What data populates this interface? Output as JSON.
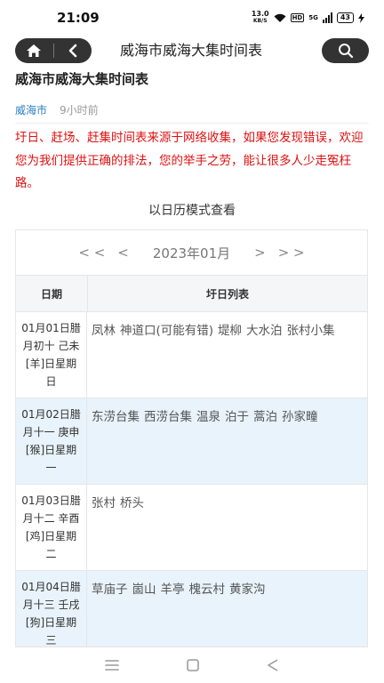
{
  "status_bar": {
    "time": "21:09",
    "net_speed": "13.0",
    "net_unit": "KB/S",
    "hd": "HD",
    "signal": "5G",
    "battery": "43"
  },
  "header": {
    "title": "威海市威海大集时间表",
    "home_icon": "home-icon",
    "back_icon": "back-icon",
    "search_icon": "search-icon"
  },
  "article": {
    "title": "威海市威海大集时间表",
    "source": "威海市",
    "time_ago": "9小时前",
    "notice": "圩日、赶场、赶集时间表来源于网络收集，如果您发现错误，欢迎您为我们提供正确的排法，您的举手之劳，能让很多人少走冤枉路。"
  },
  "calendar": {
    "heading": "以日历模式查看",
    "nav": {
      "first": "< <",
      "prev": "<",
      "month": "2023年01月",
      "next": ">",
      "last": "> >"
    },
    "col_date": "日期",
    "col_list": "圩日列表",
    "rows": [
      {
        "date": "01月01日腊月初十 己未[羊]日星期日",
        "markets": [
          "凤林",
          "神道口(可能有错)",
          "堤柳",
          "大水泊",
          "张村小集"
        ]
      },
      {
        "date": "01月02日腊月十一 庚申[猴]日星期一",
        "markets": [
          "东涝台集",
          "西涝台集",
          "温泉",
          "泊于",
          "蒿泊",
          "孙家疃"
        ]
      },
      {
        "date": "01月03日腊月十二 辛酉[鸡]日星期二",
        "markets": [
          "张村",
          "桥头"
        ]
      },
      {
        "date": "01月04日腊月十三 壬戌[狗]日星期三",
        "markets": [
          "草庙子",
          "崮山",
          "羊亭",
          "槐云村",
          "黄家沟"
        ]
      }
    ]
  }
}
